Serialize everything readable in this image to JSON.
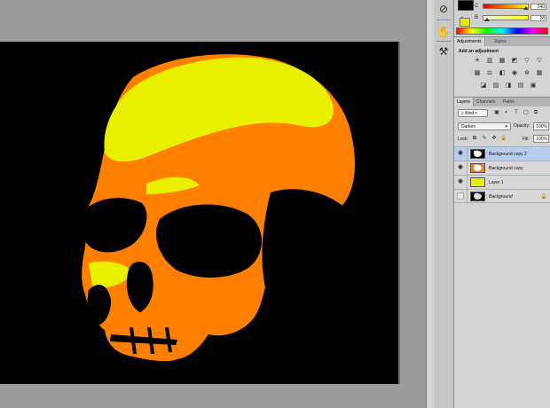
{
  "colors": {
    "workspace": "#9b9b9b",
    "canvas_bg": "#000000",
    "skull_orange": "#ff7f00",
    "skull_yellow": "#e8f000",
    "selected_row": "#b9cdec"
  },
  "tools": [
    {
      "icon": "eyedropper-icon"
    },
    {
      "icon": "hand-stamp-icon"
    },
    {
      "icon": "tool-presets-icon"
    }
  ],
  "color_panel": {
    "foreground": "#000000",
    "background_swatch": "#eaea00",
    "channels": [
      {
        "label": "C",
        "value": "240"
      },
      {
        "label": "B",
        "value": "28"
      }
    ]
  },
  "adjustments_panel": {
    "tabs": [
      {
        "label": "Adjustments",
        "active": true
      },
      {
        "label": "Styles",
        "active": false
      }
    ],
    "title": "Add an adjustment",
    "icon_rows": [
      [
        "brightness-icon",
        "levels-icon",
        "curves-icon",
        "exposure-icon",
        "vibrance-icon",
        "triangle-icon"
      ],
      [
        "hue-sat-icon",
        "color-balance-icon",
        "black-white-icon",
        "photo-filter-icon",
        "channel-mixer-icon",
        "grid-icon"
      ],
      [
        "invert-icon",
        "posterize-icon",
        "threshold-icon",
        "gradient-map-icon",
        "selective-color-icon"
      ]
    ]
  },
  "layers_panel": {
    "tabs": [
      {
        "label": "Layers",
        "active": true
      },
      {
        "label": "Channels",
        "active": false
      },
      {
        "label": "Paths",
        "active": false
      }
    ],
    "kind_label": "Kind",
    "blend_mode": "Darken",
    "opacity_label": "Opacity:",
    "opacity_value": "100%",
    "lock_label": "Lock:",
    "fill_label": "Fill:",
    "fill_value": "100%",
    "layers": [
      {
        "name": "Background copy 2",
        "visible": true,
        "selected": true,
        "thumb": "skull-bw"
      },
      {
        "name": "Background copy",
        "visible": true,
        "selected": false,
        "thumb": "skull-orange"
      },
      {
        "name": "Layer 1",
        "visible": true,
        "selected": false,
        "thumb": "yellow"
      },
      {
        "name": "Background",
        "visible": false,
        "selected": false,
        "thumb": "skull-bw",
        "locked": true
      }
    ]
  }
}
